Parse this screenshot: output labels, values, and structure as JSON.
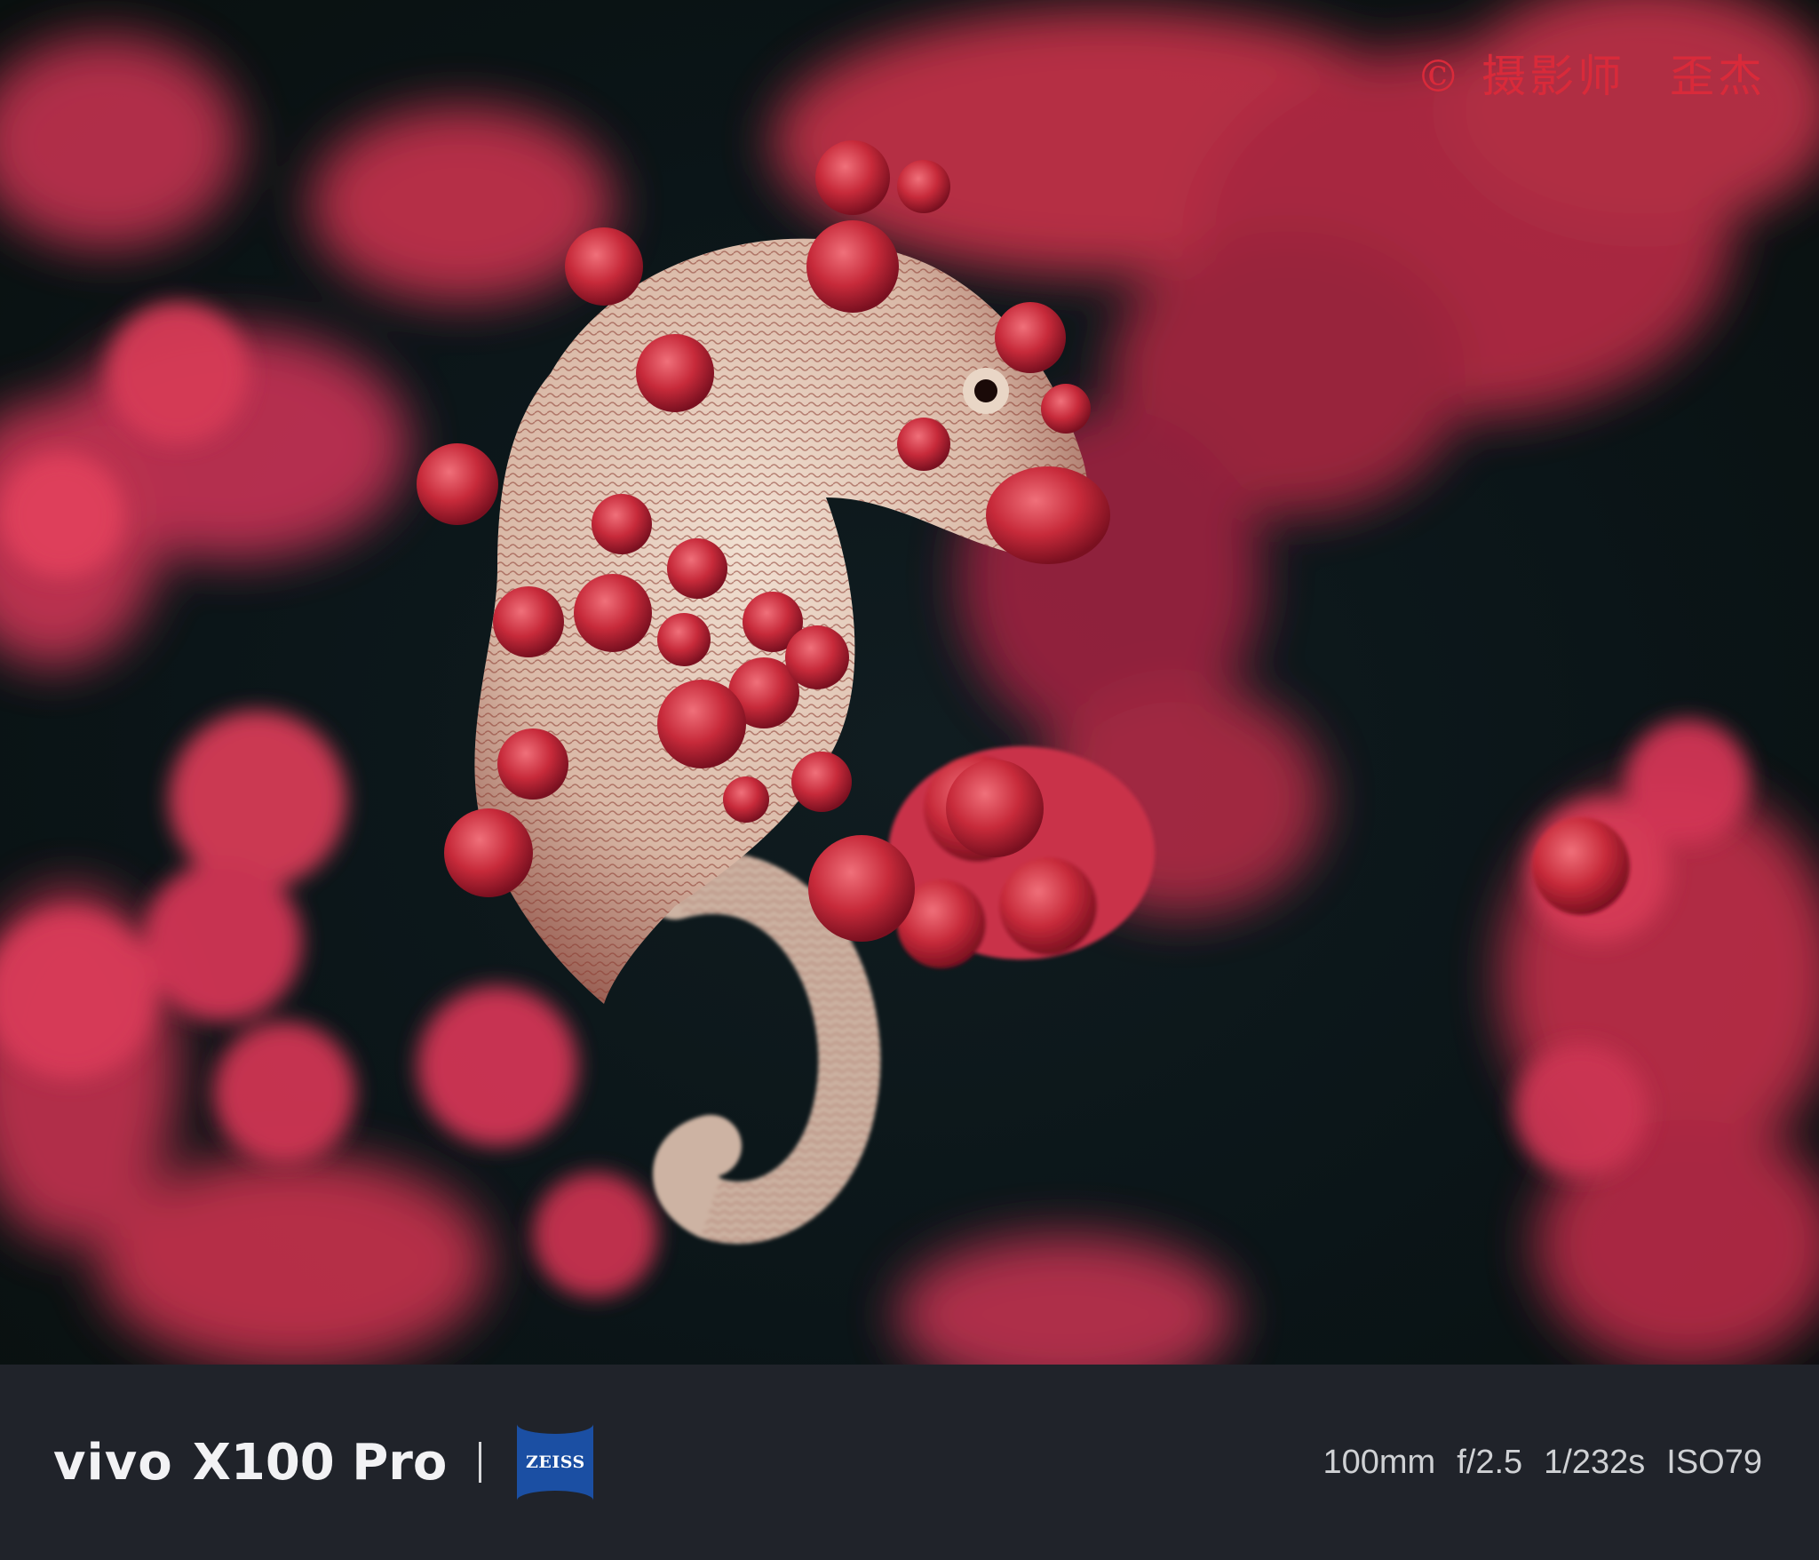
{
  "photo": {
    "subject": "pygmy-seahorse-on-red-gorgonian-coral",
    "background_color": "#0b1518",
    "coral_color": "#d8344f",
    "seahorse_color": "#e8d6c6"
  },
  "watermark": {
    "copyright_symbol": "©",
    "photographer_label": "摄影师",
    "photographer_name": "歪杰",
    "color": "#d92a3a"
  },
  "info_bar": {
    "brand": "vivo",
    "model": "X100 Pro",
    "partner_logo": "ZEISS",
    "exif": {
      "focal_length": "100mm",
      "aperture": "f/2.5",
      "shutter": "1/232s",
      "iso": "ISO79"
    },
    "background_color": "#20232a"
  }
}
